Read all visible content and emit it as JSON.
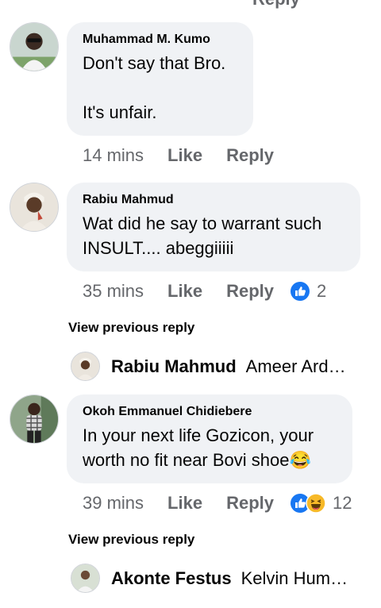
{
  "comments": [
    {
      "author": "Muhammad M. Kumo",
      "text": "Don't say that Bro.\n\nIt's unfair.",
      "time": "14 mins",
      "like": "Like",
      "reply": "Reply"
    },
    {
      "author": "Rabiu Mahmud",
      "text": "Wat did he say to warrant such INSULT.... abeggiiiii",
      "time": "35 mins",
      "like": "Like",
      "reply": "Reply",
      "reaction_count": "2",
      "reaction_icons": [
        "like-icon"
      ],
      "view_previous": "View previous reply",
      "reply_preview": {
        "author": "Rabiu Mahmud",
        "snippet": "Ameer Ard…"
      }
    },
    {
      "author": "Okoh Emmanuel Chidiebere",
      "text": "In your next life Gozicon, your worth no fit near Bovi shoe😂",
      "time": "39 mins",
      "like": "Like",
      "reply": "Reply",
      "reaction_count": "12",
      "reaction_icons": [
        "like-icon",
        "haha-icon"
      ],
      "view_previous": "View previous reply",
      "reply_preview": {
        "author": "Akonte Festus",
        "snippet": "Kelvin Hum…"
      }
    }
  ],
  "colors": {
    "bubble": "#f0f2f5",
    "meta": "#65676b",
    "like_blue": "#1877f2",
    "haha_yellow": "#f7b928"
  }
}
